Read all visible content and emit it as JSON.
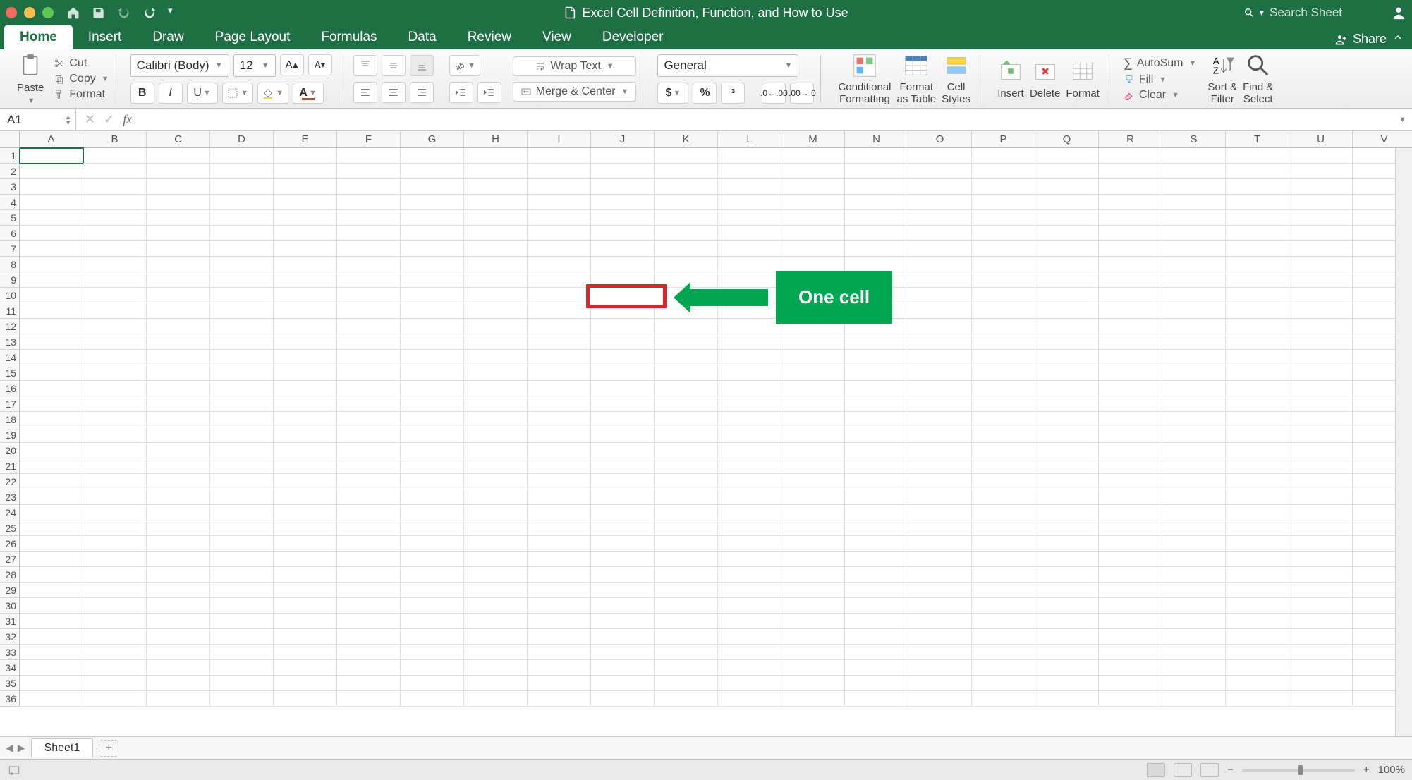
{
  "title_bar": {
    "doc_title": "Excel Cell Definition, Function, and How to Use",
    "search_placeholder": "Search Sheet"
  },
  "tabs": {
    "items": [
      "Home",
      "Insert",
      "Draw",
      "Page Layout",
      "Formulas",
      "Data",
      "Review",
      "View",
      "Developer"
    ],
    "active_index": 0,
    "share_label": "Share"
  },
  "ribbon": {
    "clipboard": {
      "paste": "Paste",
      "cut": "Cut",
      "copy": "Copy",
      "format": "Format"
    },
    "font": {
      "name": "Calibri (Body)",
      "size": "12",
      "bold": "B",
      "italic": "I",
      "underline": "U"
    },
    "alignment": {
      "wrap": "Wrap Text",
      "merge": "Merge & Center"
    },
    "number": {
      "format": "General"
    },
    "styles": {
      "conditional": "Conditional\nFormatting",
      "table": "Format\nas Table",
      "cell": "Cell\nStyles"
    },
    "cells": {
      "insert": "Insert",
      "delete": "Delete",
      "format": "Format"
    },
    "editing": {
      "autosum": "AutoSum",
      "fill": "Fill",
      "clear": "Clear",
      "sort": "Sort &\nFilter",
      "find": "Find &\nSelect"
    }
  },
  "formula_bar": {
    "name_box": "A1",
    "fx_label": "fx",
    "formula_value": ""
  },
  "grid": {
    "columns": [
      "A",
      "B",
      "C",
      "D",
      "E",
      "F",
      "G",
      "H",
      "I",
      "J",
      "K",
      "L",
      "M",
      "N",
      "O",
      "P",
      "Q",
      "R",
      "S",
      "T",
      "U",
      "V"
    ],
    "row_count": 36,
    "active_cell": "A1"
  },
  "annotation": {
    "label": "One cell"
  },
  "sheet_tabs": {
    "current": "Sheet1"
  },
  "status_bar": {
    "zoom": "100%"
  }
}
